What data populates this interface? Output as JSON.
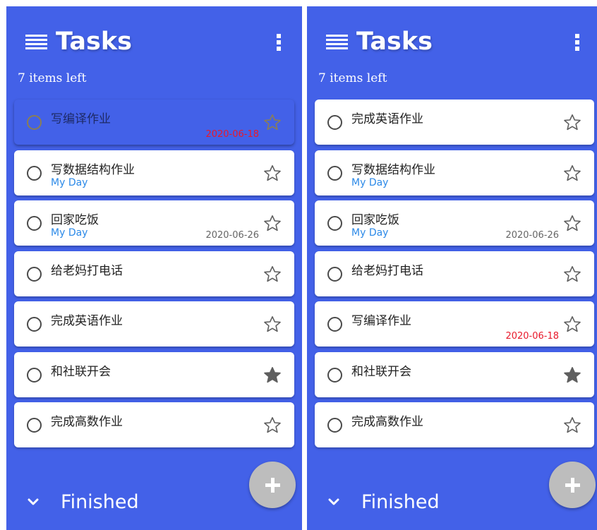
{
  "app": {
    "title": "Tasks",
    "items_left": "7 items left",
    "finished_label": "Finished"
  },
  "colors": {
    "primary": "#4361e8",
    "card": "#ffffff",
    "tag": "#2b89e8",
    "overdue": "#e8192b",
    "date": "#666666",
    "fab": "#bdbdbd"
  },
  "icons": {
    "menu": "menu-icon",
    "more": "more-vertical-icon",
    "check": "circle-outline-icon",
    "star_outline": "star-outline-icon",
    "star_filled": "star-filled-icon",
    "chevron": "chevron-down-icon",
    "add": "plus-icon"
  },
  "panels": [
    {
      "tasks": [
        {
          "title": "写编译作业",
          "tag": "",
          "date": "2020-06-18",
          "overdue": true,
          "starred": false,
          "selected": true
        },
        {
          "title": "写数据结构作业",
          "tag": "My Day",
          "date": "",
          "overdue": false,
          "starred": false,
          "selected": false
        },
        {
          "title": "回家吃饭",
          "tag": "My Day",
          "date": "2020-06-26",
          "overdue": false,
          "starred": false,
          "selected": false
        },
        {
          "title": "给老妈打电话",
          "tag": "",
          "date": "",
          "overdue": false,
          "starred": false,
          "selected": false
        },
        {
          "title": "完成英语作业",
          "tag": "",
          "date": "",
          "overdue": false,
          "starred": false,
          "selected": false
        },
        {
          "title": "和社联开会",
          "tag": "",
          "date": "",
          "overdue": false,
          "starred": true,
          "selected": false
        },
        {
          "title": "完成高数作业",
          "tag": "",
          "date": "",
          "overdue": false,
          "starred": false,
          "selected": false
        }
      ]
    },
    {
      "tasks": [
        {
          "title": "完成英语作业",
          "tag": "",
          "date": "",
          "overdue": false,
          "starred": false,
          "selected": false
        },
        {
          "title": "写数据结构作业",
          "tag": "My Day",
          "date": "",
          "overdue": false,
          "starred": false,
          "selected": false
        },
        {
          "title": "回家吃饭",
          "tag": "My Day",
          "date": "2020-06-26",
          "overdue": false,
          "starred": false,
          "selected": false
        },
        {
          "title": "给老妈打电话",
          "tag": "",
          "date": "",
          "overdue": false,
          "starred": false,
          "selected": false
        },
        {
          "title": "写编译作业",
          "tag": "",
          "date": "2020-06-18",
          "overdue": true,
          "starred": false,
          "selected": false
        },
        {
          "title": "和社联开会",
          "tag": "",
          "date": "",
          "overdue": false,
          "starred": true,
          "selected": false
        },
        {
          "title": "完成高数作业",
          "tag": "",
          "date": "",
          "overdue": false,
          "starred": false,
          "selected": false
        }
      ]
    }
  ]
}
